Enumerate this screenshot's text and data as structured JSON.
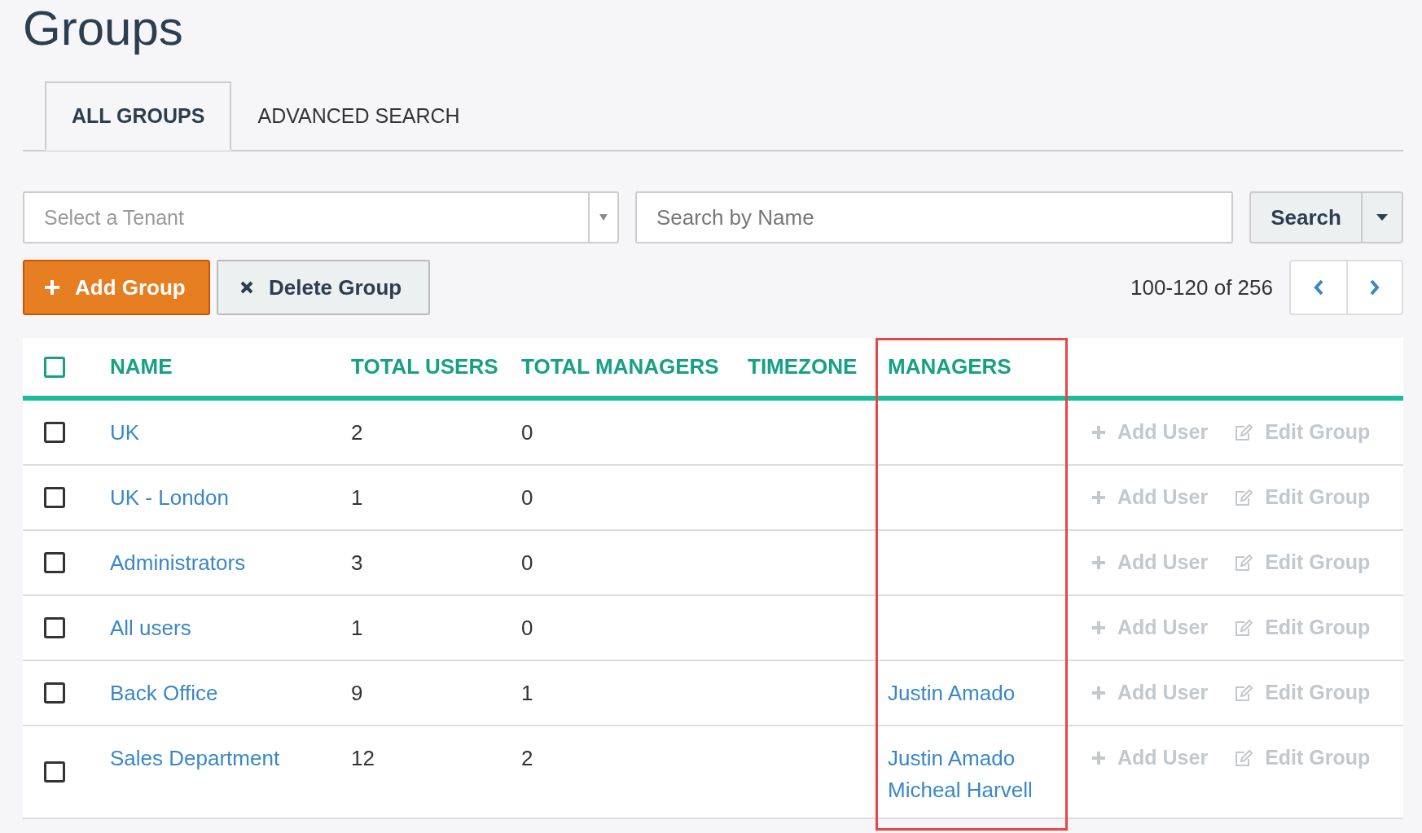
{
  "page_title": "Groups",
  "tabs": [
    {
      "label": "ALL GROUPS",
      "selected": true
    },
    {
      "label": "ADVANCED SEARCH",
      "selected": false
    }
  ],
  "tenant_select": {
    "placeholder": "Select a Tenant"
  },
  "search": {
    "placeholder": "Search by Name",
    "button": "Search"
  },
  "actions": [
    {
      "kind": "add",
      "label": "Add Group"
    },
    {
      "kind": "delete",
      "label": "Delete Group"
    }
  ],
  "pagination": {
    "range": "100-120 of 256"
  },
  "table": {
    "select_all_checked": false,
    "columns": [
      {
        "label": "NAME",
        "highlighted": false
      },
      {
        "label": "TOTAL USERS",
        "highlighted": false
      },
      {
        "label": "TOTAL MANAGERS",
        "highlighted": false
      },
      {
        "label": "TIMEZONE",
        "highlighted": false
      },
      {
        "label": "MANAGERS",
        "highlighted": true
      }
    ],
    "rows": [
      {
        "checked": false,
        "name": "UK",
        "total_users": "2",
        "total_managers": "0",
        "managers": [],
        "add_user": "Add User",
        "edit_group": "Edit Group"
      },
      {
        "checked": false,
        "name": "UK - London",
        "total_users": "1",
        "total_managers": "0",
        "managers": [],
        "add_user": "Add User",
        "edit_group": "Edit Group"
      },
      {
        "checked": false,
        "name": "Administrators",
        "total_users": "3",
        "total_managers": "0",
        "managers": [],
        "add_user": "Add User",
        "edit_group": "Edit Group"
      },
      {
        "checked": false,
        "name": "All users",
        "total_users": "1",
        "total_managers": "0",
        "managers": [],
        "add_user": "Add User",
        "edit_group": "Edit Group"
      },
      {
        "checked": false,
        "name": "Back Office",
        "total_users": "9",
        "total_managers": "1",
        "managers": [
          "Justin Amado"
        ],
        "add_user": "Add User",
        "edit_group": "Edit Group"
      },
      {
        "checked": false,
        "name": "Sales Department",
        "total_users": "12",
        "total_managers": "2",
        "managers": [
          "Justin Amado",
          "Micheal Harvell"
        ],
        "add_user": "Add User",
        "edit_group": "Edit Group"
      }
    ]
  }
}
